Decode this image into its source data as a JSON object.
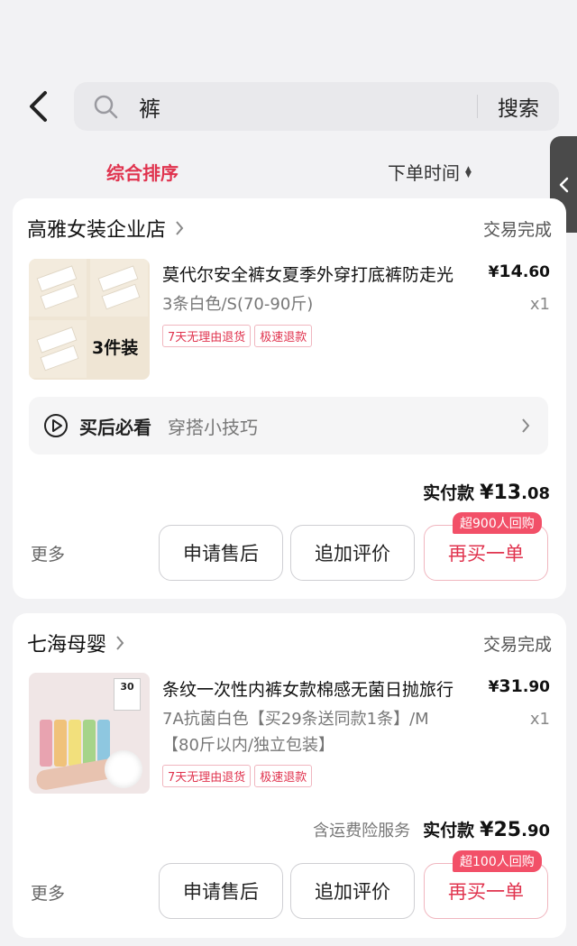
{
  "search": {
    "query": "裤",
    "button_label": "搜索"
  },
  "filters": {
    "sort_label": "综合排序",
    "time_label": "下单时间",
    "active_color": "#e0334e"
  },
  "orders": [
    {
      "shop_name": "高雅女装企业店",
      "status": "交易完成",
      "thumb_badge": "3件装",
      "title": "莫代尔安全裤女夏季外穿打底裤防走光",
      "price_symbol": "¥",
      "price_int": "14",
      "price_dec": ".60",
      "quantity": "x1",
      "spec": "3条白色/S(70-90斤)",
      "tags": [
        "7天无理由退货",
        "极速退款"
      ],
      "tip_title": "买后必看",
      "tip_sub": "穿搭小技巧",
      "paid_label": "实付款",
      "paid_symbol": "¥",
      "paid_int": "13",
      "paid_dec": ".08",
      "more_label": "更多",
      "after_sale_label": "申请售后",
      "review_label": "追加评价",
      "rebuy_label": "再买一单",
      "rebuy_badge": "超900人回购"
    },
    {
      "shop_name": "七海母婴",
      "status": "交易完成",
      "thumb_box": "30",
      "title": "条纹一次性内裤女款棉感无菌日抛旅行",
      "price_symbol": "¥",
      "price_int": "31",
      "price_dec": ".90",
      "quantity": "x1",
      "spec_line1": "7A抗菌白色【买29条送同款1条】/M",
      "spec_line2": "【80斤以内/独立包装】",
      "tags": [
        "7天无理由退货",
        "极速退款"
      ],
      "paid_note": "含运费险服务",
      "paid_label": "实付款",
      "paid_symbol": "¥",
      "paid_int": "25",
      "paid_dec": ".90",
      "more_label": "更多",
      "after_sale_label": "申请售后",
      "review_label": "追加评价",
      "rebuy_label": "再买一单",
      "rebuy_badge": "超100人回购"
    }
  ],
  "icons": [
    "back-chevron-icon",
    "search-icon",
    "sort-arrows-icon",
    "side-collapse-icon",
    "chevron-right-icon",
    "play-circle-icon"
  ]
}
